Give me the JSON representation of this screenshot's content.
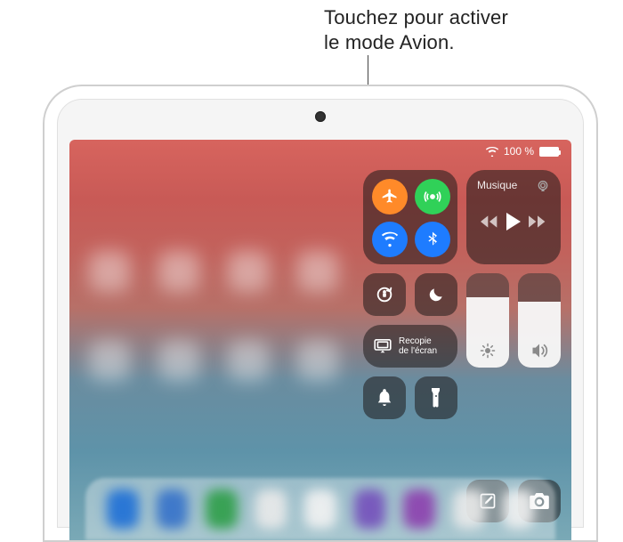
{
  "callout": "Touchez pour activer\nle mode Avion.",
  "status": {
    "battery_pct": "100 %"
  },
  "control_center": {
    "connectivity": {
      "airplane_mode": {
        "name": "airplane-mode-toggle",
        "on": true
      },
      "airdrop": {
        "name": "airdrop-toggle",
        "on": true
      },
      "wifi": {
        "name": "wifi-toggle",
        "on": true
      },
      "bluetooth": {
        "name": "bluetooth-toggle",
        "on": true
      }
    },
    "music": {
      "title": "Musique",
      "prev": "previous-track",
      "play": "play-pause",
      "next": "next-track",
      "airplay_audio": "airplay-audio"
    },
    "rotation_lock": {
      "label": "rotation-lock-toggle"
    },
    "dnd": {
      "label": "do-not-disturb-toggle"
    },
    "screen_mirror_label": "Recopie\nde l'écran",
    "brightness_pct": 75,
    "volume_pct": 70,
    "bottom": {
      "mute": "mute-toggle",
      "flashlight": "flashlight-toggle",
      "notes": "quick-note",
      "camera": "camera-shortcut"
    }
  },
  "colors": {
    "airplane": "#ff8a29",
    "airdrop": "#30d158",
    "wifi_bt": "#1e7cff",
    "tile_bg": "rgba(30,25,25,0.55)"
  }
}
